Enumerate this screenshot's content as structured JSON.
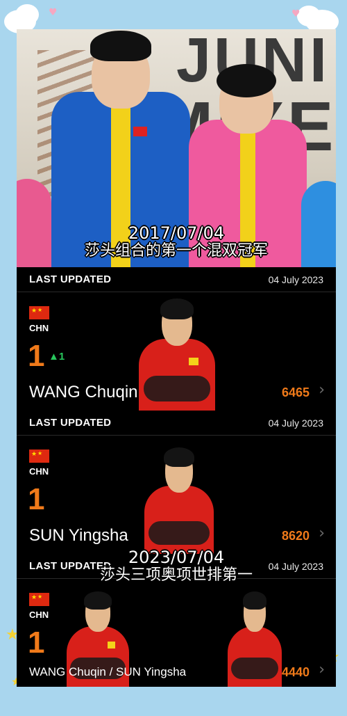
{
  "overlay": {
    "caption_top_date": "2017/07/04",
    "caption_top_text": "莎头组合的第一个混双冠军",
    "caption_mid_date": "2023/07/04",
    "caption_mid_text": "莎头三项奥项世排第一"
  },
  "photo": {
    "backdrop_line1": "JUNI",
    "backdrop_line2": "MIXE"
  },
  "rankings": [
    {
      "updated_label": "LAST UPDATED",
      "updated_date": "04 July 2023",
      "country": "CHN",
      "rank": "1",
      "change": "▲1",
      "name": "WANG Chuqin",
      "points": "6465"
    },
    {
      "updated_label": "LAST UPDATED",
      "updated_date": "04 July 2023",
      "country": "CHN",
      "rank": "1",
      "change": "",
      "name": "SUN Yingsha",
      "points": "8620"
    },
    {
      "updated_label": "LAST UPDATED",
      "updated_date": "04 July 2023",
      "country": "CHN",
      "rank": "1",
      "change": "",
      "name": "WANG Chuqin / SUN Yingsha",
      "points": "4440"
    }
  ],
  "icons": {
    "chevron": "chevron-right-icon",
    "flag": "china-flag-icon"
  },
  "colors": {
    "rank": "#f07a1a",
    "change_up": "#27c65c",
    "card_bg": "#000000",
    "frame": "#a9d6ee"
  }
}
